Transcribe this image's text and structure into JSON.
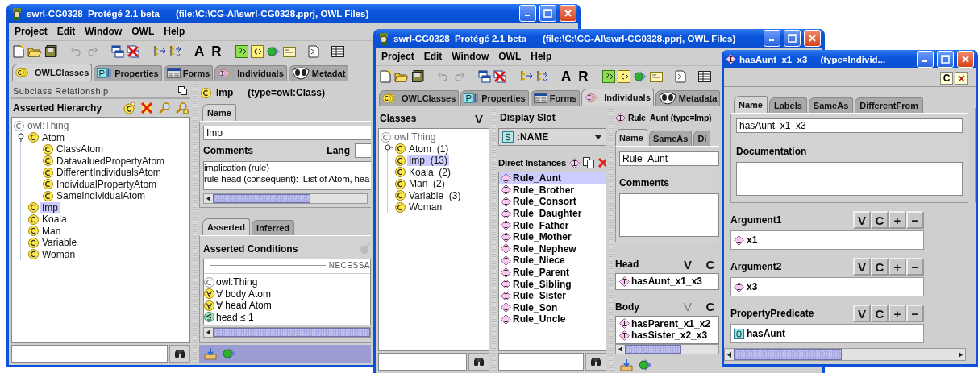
{
  "classes_window": {
    "title": "swrl-CG0328  Protégé 2.1 beta",
    "file": "(file:\\C:\\CG-AI\\swrl-CG0328.pprj, OWL Files)",
    "menu": [
      "Project",
      "Edit",
      "Window",
      "OWL",
      "Help"
    ],
    "toolbar_letters": [
      "A",
      "R"
    ],
    "tabs": [
      {
        "label": "OWLClasses",
        "selected": true
      },
      {
        "label": "Properties",
        "selected": false
      },
      {
        "label": "Forms",
        "selected": false
      },
      {
        "label": "Individuals",
        "selected": false
      },
      {
        "label": "Metadat",
        "selected": false
      }
    ],
    "relationship": "Subclass Relationship",
    "hierarchy_title": "Asserted Hierarchy",
    "tree": [
      {
        "label": "owl:Thing",
        "selected": false,
        "children": [
          {
            "label": "Atom",
            "selected": false,
            "expanded": true,
            "children": [
              {
                "label": "ClassAtom",
                "selected": false
              },
              {
                "label": "DatavaluedPropertyAtom",
                "selected": false
              },
              {
                "label": "DifferentIndividualsAtom",
                "selected": false
              },
              {
                "label": "IndividualPropertyAtom",
                "selected": false
              },
              {
                "label": "SameIndividualAtom",
                "selected": false
              }
            ]
          },
          {
            "label": "Imp",
            "selected": true
          },
          {
            "label": "Koala",
            "selected": false
          },
          {
            "label": "Man",
            "selected": false
          },
          {
            "label": "Variable",
            "selected": false
          },
          {
            "label": "Woman",
            "selected": false
          }
        ]
      }
    ],
    "class_header": {
      "name": "Imp",
      "type": "(type=owl:Class)"
    },
    "name_tabs": [
      {
        "label": "Name",
        "selected": true
      }
    ],
    "name_value": "Imp",
    "comments_label": "Comments",
    "lang_label": "Lang",
    "comments": [
      "implication (rule)",
      "rule head (consequent):  List of Atom, hea"
    ],
    "condition_tabs": [
      {
        "label": "Asserted",
        "selected": true
      },
      {
        "label": "Inferred",
        "selected": false
      }
    ],
    "conditions_title": "Asserted Conditions",
    "separator": "NECESSA",
    "conditions": [
      {
        "kind": "class",
        "text": "owl:Thing"
      },
      {
        "kind": "all",
        "text": "∀ body Atom"
      },
      {
        "kind": "all",
        "text": "∀ head Atom"
      },
      {
        "kind": "max",
        "text": "head ≤ 1"
      }
    ]
  },
  "individuals_window": {
    "title": "swrl-CG0328  Protégé 2.1 beta",
    "file": "(file:\\C:\\CG-AI\\swrl-CG0328.pprj, OWL Files)",
    "menu": [
      "Project",
      "Edit",
      "Window",
      "OWL",
      "Help"
    ],
    "toolbar_letters": [
      "A",
      "R"
    ],
    "tabs": [
      {
        "label": "OWLClasses",
        "selected": false
      },
      {
        "label": "Properties",
        "selected": false
      },
      {
        "label": "Forms",
        "selected": false
      },
      {
        "label": "Individuals",
        "selected": true
      },
      {
        "label": "Metadata",
        "selected": false
      }
    ],
    "classes_title": "Classes",
    "classes_button": "V",
    "tree": [
      {
        "label": "owl:Thing",
        "selected": false,
        "children": [
          {
            "label": "Atom  (1)",
            "selected": false,
            "expanded": false
          },
          {
            "label": "Imp  (13)",
            "selected": true
          },
          {
            "label": "Koala  (2)",
            "selected": false
          },
          {
            "label": "Man  (2)",
            "selected": false
          },
          {
            "label": "Variable  (3)",
            "selected": false
          },
          {
            "label": "Woman",
            "selected": false
          }
        ]
      }
    ],
    "display_slot_title": "Display Slot",
    "slot_value": ":NAME",
    "instances_title": "Direct Instances",
    "instances": [
      {
        "label": "Rule_Aunt",
        "selected": true
      },
      {
        "label": "Rule_Brother",
        "selected": false
      },
      {
        "label": "Rule_Consort",
        "selected": false
      },
      {
        "label": "Rule_Daughter",
        "selected": false
      },
      {
        "label": "Rule_Father",
        "selected": false
      },
      {
        "label": "Rule_Mother",
        "selected": false
      },
      {
        "label": "Rule_Nephew",
        "selected": false
      },
      {
        "label": "Rule_Niece",
        "selected": false
      },
      {
        "label": "Rule_Parent",
        "selected": false
      },
      {
        "label": "Rule_Sibling",
        "selected": false
      },
      {
        "label": "Rule_Sister",
        "selected": false
      },
      {
        "label": "Rule_Son",
        "selected": false
      },
      {
        "label": "Rule_Uncle",
        "selected": false
      }
    ],
    "instance_header": {
      "name": "Rule_Aunt",
      "type": "(type=Imp)"
    },
    "name_tabs": [
      {
        "label": "Name",
        "selected": true
      },
      {
        "label": "SameAs",
        "selected": false
      },
      {
        "label": "Di",
        "selected": false
      }
    ],
    "name_value": "Rule_Aunt",
    "comments_label": "Comments",
    "slots": [
      {
        "label": "Head",
        "buttons": [
          {
            "label": "V",
            "disabled": false
          },
          {
            "label": "C",
            "disabled": false
          }
        ],
        "items": [
          "hasAunt_x1_x3"
        ]
      },
      {
        "label": "Body",
        "buttons": [
          {
            "label": "V",
            "disabled": true
          },
          {
            "label": "C",
            "disabled": false
          }
        ],
        "items": [
          "hasParent_x1_x2",
          "hasSister_x2_x3"
        ]
      }
    ]
  },
  "instance_window": {
    "title": "hasAunt_x1_x3",
    "type": "(type=Individ...",
    "corner_button": "C",
    "tabs": [
      {
        "label": "Name",
        "selected": true
      },
      {
        "label": "Labels",
        "selected": false
      },
      {
        "label": "SameAs",
        "selected": false
      },
      {
        "label": "DifferentFrom",
        "selected": false
      }
    ],
    "name_value": "hasAunt_x1_x3",
    "documentation_label": "Documentation",
    "slots": [
      {
        "label": "Argument1",
        "kind": "individual",
        "value": "x1",
        "buttons": [
          "V",
          "C",
          "+",
          "−"
        ]
      },
      {
        "label": "Argument2",
        "kind": "individual",
        "value": "x3",
        "buttons": [
          "V",
          "C",
          "+",
          "−"
        ]
      },
      {
        "label": "PropertyPredicate",
        "kind": "property",
        "value": "hasAunt",
        "buttons": [
          "V",
          "C",
          "+",
          "−"
        ]
      }
    ]
  }
}
